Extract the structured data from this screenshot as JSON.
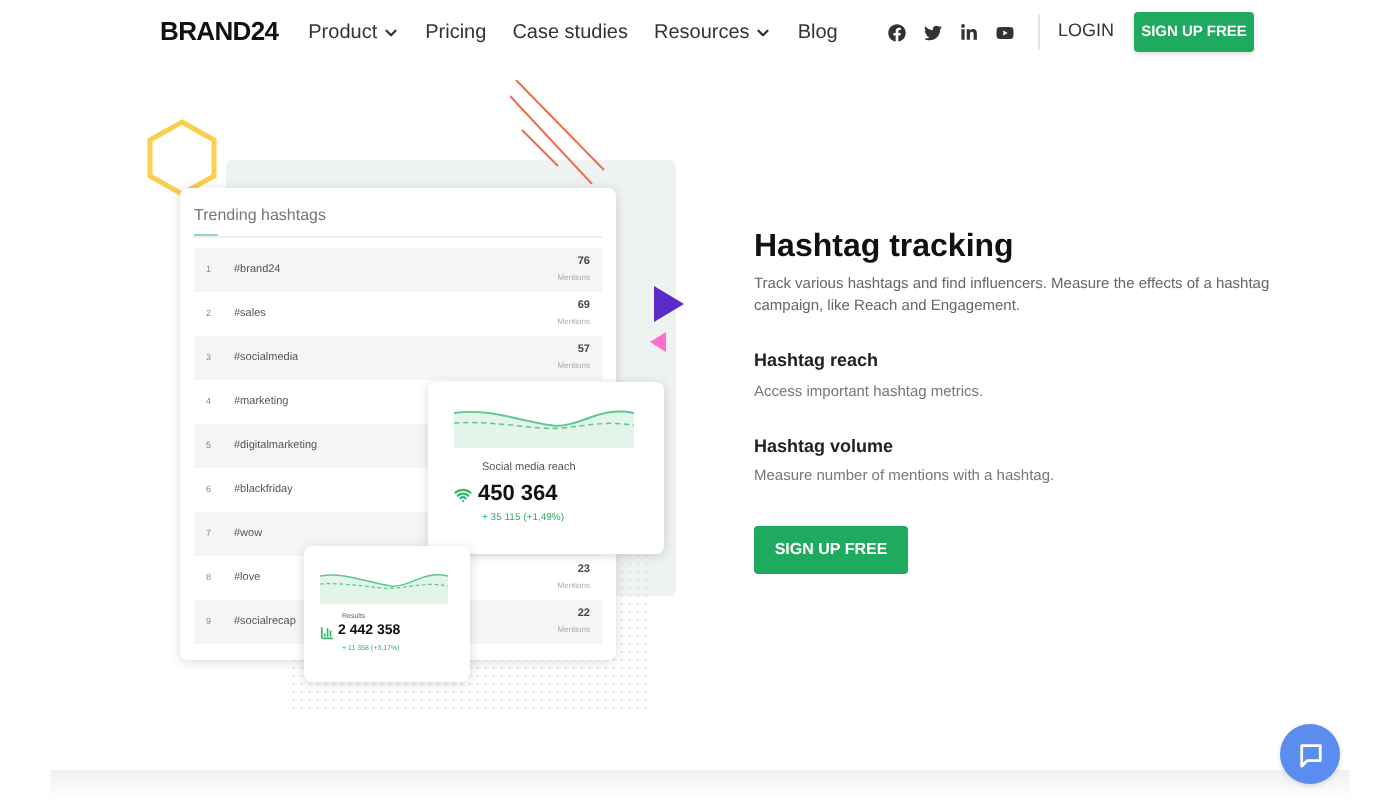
{
  "nav": {
    "logo": "BRAND24",
    "links": [
      {
        "label": "Product",
        "dropdown": true
      },
      {
        "label": "Pricing",
        "dropdown": false
      },
      {
        "label": "Case studies",
        "dropdown": false
      },
      {
        "label": "Resources",
        "dropdown": true
      },
      {
        "label": "Blog",
        "dropdown": false
      }
    ],
    "login": "LOGIN",
    "signup": "SIGN UP FREE"
  },
  "illustration": {
    "table": {
      "title": "Trending hashtags",
      "rows": [
        {
          "index": "1",
          "tag": "#brand24",
          "count": "76",
          "unit": "Mentions"
        },
        {
          "index": "2",
          "tag": "#sales",
          "count": "69",
          "unit": "Mentions"
        },
        {
          "index": "3",
          "tag": "#socialmedia",
          "count": "57",
          "unit": "Mentions"
        },
        {
          "index": "4",
          "tag": "#marketing"
        },
        {
          "index": "5",
          "tag": "#digitalmarketing"
        },
        {
          "index": "6",
          "tag": "#blackfriday"
        },
        {
          "index": "7",
          "tag": "#wow"
        },
        {
          "index": "8",
          "tag": "#love",
          "count": "23",
          "unit": "Mentions"
        },
        {
          "index": "9",
          "tag": "#socialrecap",
          "count": "22",
          "unit": "Mentions"
        }
      ]
    },
    "reach_card": {
      "label": "Social media reach",
      "value": "450 364",
      "change": "+ 35 115 (+1,49%)"
    },
    "results_card": {
      "label": "Results",
      "value": "2 442 358",
      "change": "+ 11 358 (+3,17%)"
    }
  },
  "feature": {
    "title": "Hashtag tracking",
    "description": "Track various hashtags and find influencers. Measure the effects of a hashtag campaign, like Reach and Engagement.",
    "items": [
      {
        "title": "Hashtag reach",
        "text": "Access important hashtag metrics."
      },
      {
        "title": "Hashtag volume",
        "text": "Measure number of mentions with a hashtag."
      }
    ],
    "button": "SIGN UP FREE"
  }
}
